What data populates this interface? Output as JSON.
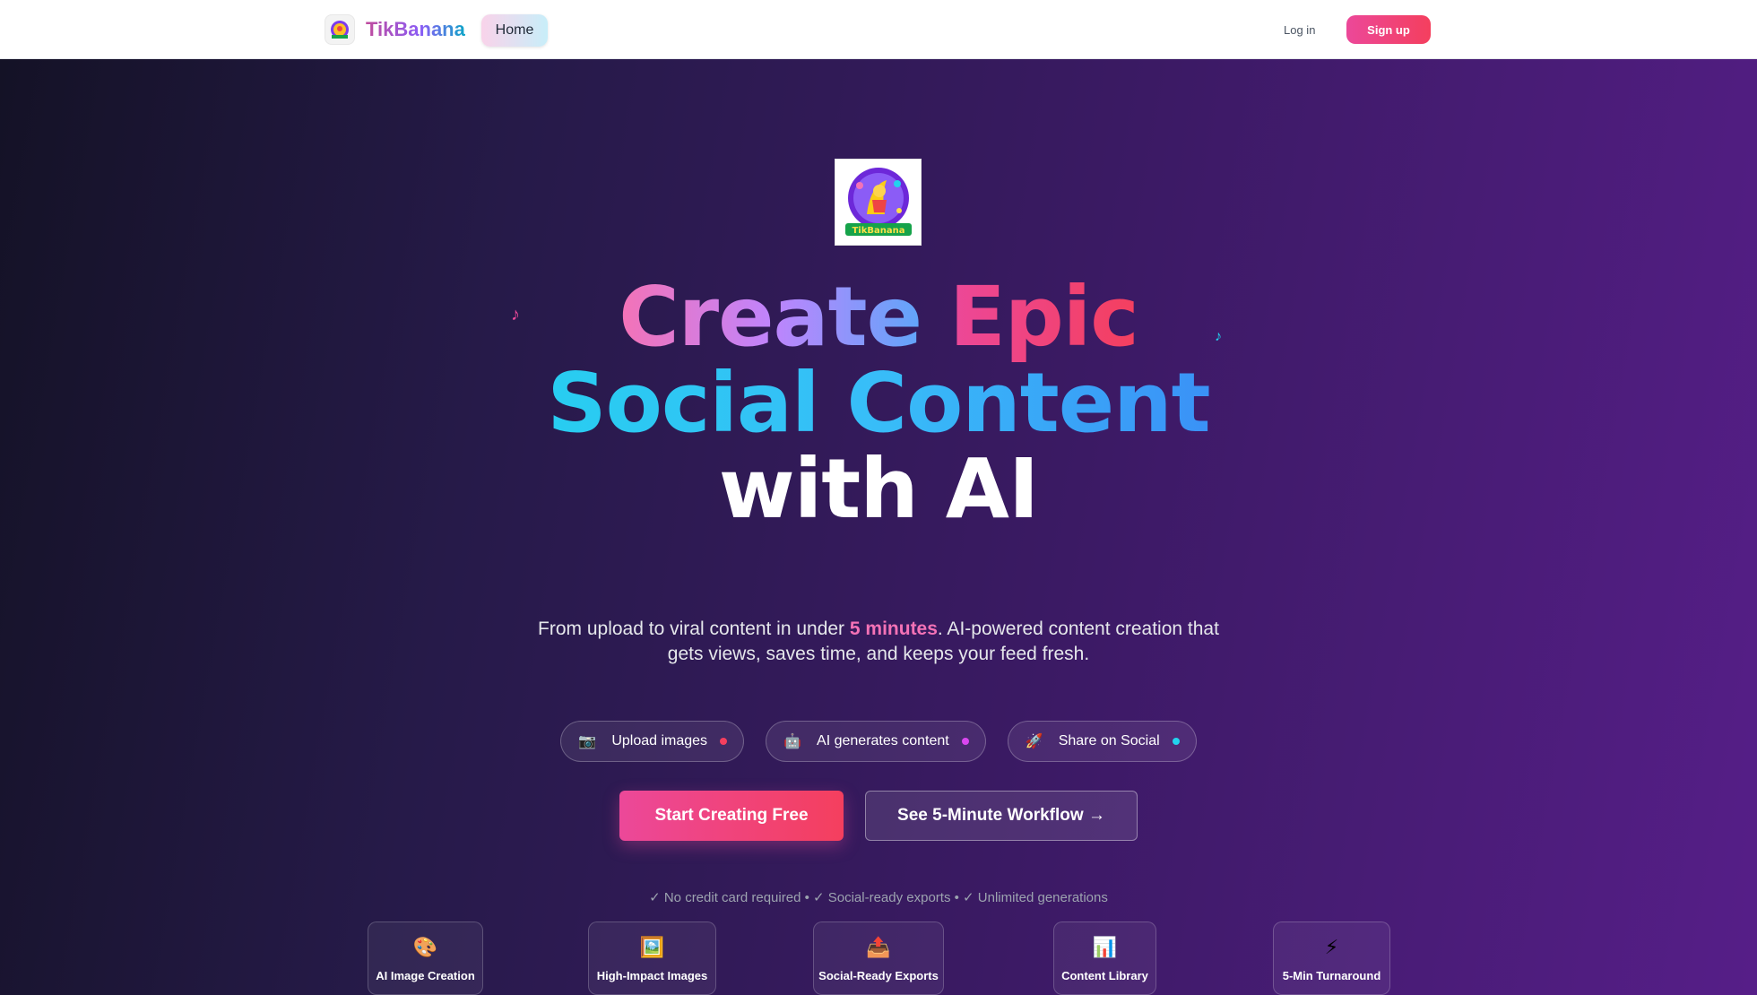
{
  "navbar": {
    "brand_name": "TikBanana",
    "home_label": "Home",
    "login_label": "Log in",
    "signup_label": "Sign up"
  },
  "hero": {
    "logo_text": "TikBanana",
    "headline": {
      "word_create": "Create",
      "word_epic": "Epic",
      "line2": "Social Content",
      "line3": "with AI"
    },
    "subtitle": {
      "before": "From upload to viral content in under ",
      "highlight": "5 minutes",
      "after": ". AI-powered content creation that gets views, saves time, and keeps your feed fresh."
    },
    "steps": [
      {
        "icon": "camera-icon",
        "glyph": "📷",
        "label": "Upload images",
        "dot_color": "#f43f5e"
      },
      {
        "icon": "robot-icon",
        "glyph": "🤖",
        "label": "AI generates content",
        "dot_color": "#d946ef"
      },
      {
        "icon": "rocket-icon",
        "glyph": "🚀",
        "label": "Share on Social",
        "dot_color": "#22d3ee"
      }
    ],
    "primary_cta": "Start Creating Free",
    "secondary_cta": "See 5-Minute Workflow →",
    "trust_line": "✓ No credit card required • ✓ Social-ready exports • ✓ Unlimited generations"
  },
  "features": [
    {
      "icon": "palette-icon",
      "glyph": "🎨",
      "label": "AI Image Creation"
    },
    {
      "icon": "framed-picture-icon",
      "glyph": "🖼️",
      "label": "High-Impact Images"
    },
    {
      "icon": "export-tray-icon",
      "glyph": "📤",
      "label": "Social-Ready Exports"
    },
    {
      "icon": "bar-chart-icon",
      "glyph": "📊",
      "label": "Content Library"
    },
    {
      "icon": "lightning-icon",
      "glyph": "⚡",
      "label": "5-Min Turnaround"
    }
  ],
  "colors": {
    "accent_pink": "#ec4899",
    "accent_cyan": "#22d3ee",
    "hero_bg_dark": "#141226",
    "hero_bg_purple": "#561e88"
  }
}
